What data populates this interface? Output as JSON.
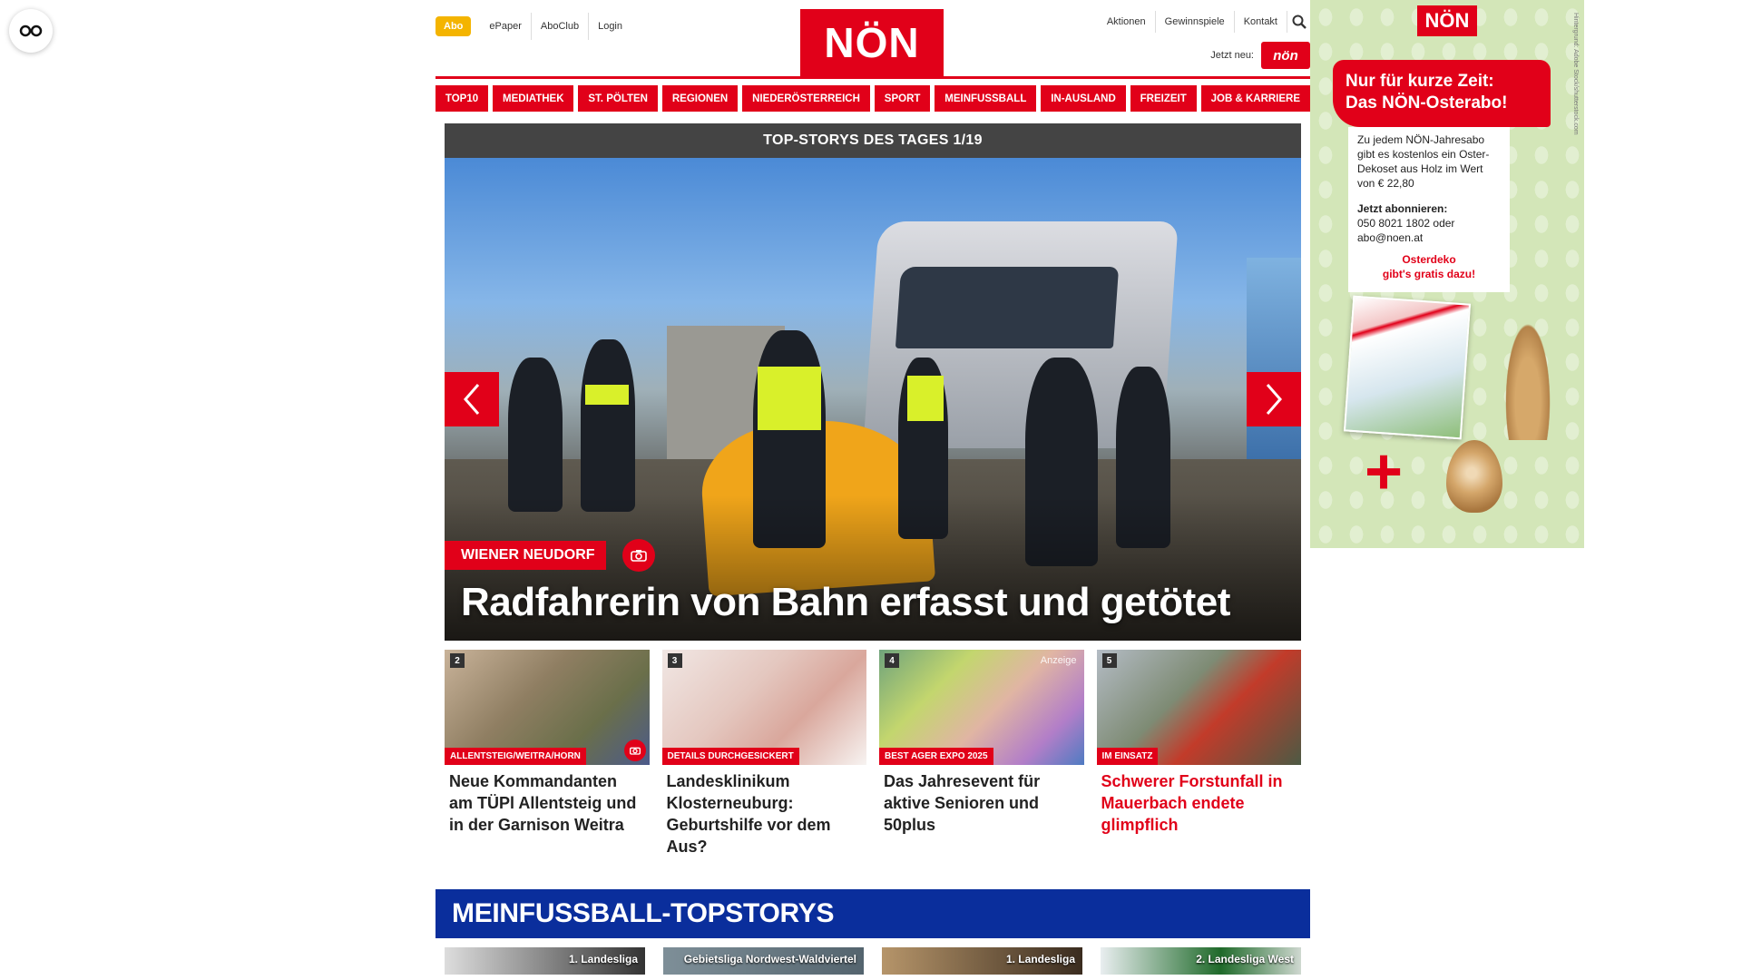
{
  "accessibility": {
    "label": "CO"
  },
  "header": {
    "abo_label": "Abo",
    "top_links": [
      "ePaper",
      "AboClub",
      "Login"
    ],
    "logo_text": "NÖN",
    "right_links": [
      "Aktionen",
      "Gewinnspiele",
      "Kontakt"
    ],
    "jetzt_label": "Jetzt neu:",
    "mini_logo_text": "nön"
  },
  "nav": {
    "items": [
      "TOP10",
      "MEDIATHEK",
      "ST. PÖLTEN",
      "REGIONEN",
      "NIEDERÖSTERREICH",
      "SPORT",
      "MEINFUSSBALL",
      "IN-AUSLAND",
      "FREIZEIT",
      "JOB & KARRIERE"
    ]
  },
  "carousel": {
    "heading": "TOP-STORYS DES TAGES 1/19",
    "kicker": "WIENER NEUDORF",
    "title": "Radfahrerin von Bahn erfasst und getötet"
  },
  "teasers": [
    {
      "rank": "2",
      "tag": "ALLENTSTEIG/WEITRA/HORN",
      "title": "Neue Kommandanten am TÜPl Allentsteig und in der Garnison Weitra",
      "ad": ""
    },
    {
      "rank": "3",
      "tag": "DETAILS DURCHGESICKERT",
      "title": "Landesklinikum Klosterneuburg: Geburtshilfe vor dem Aus?",
      "ad": ""
    },
    {
      "rank": "4",
      "tag": "BEST AGER EXPO 2025",
      "title": "Das Jahresevent für aktive Senioren und 50plus",
      "ad": "Anzeige"
    },
    {
      "rank": "5",
      "tag": "IM EINSATZ",
      "title": "Schwerer Forstunfall in Mauerbach endete glimpflich",
      "ad": ""
    }
  ],
  "section": {
    "title": "MEINFUSSBALL-TOPSTORYS",
    "items": [
      "1. Landesliga",
      "Gebietsliga Nordwest-Waldviertel",
      "1. Landesliga",
      "2. Landesliga West"
    ]
  },
  "ad": {
    "logo": "NÖN",
    "banner_line1": "Nur für kurze Zeit:",
    "banner_line2": "Das NÖN-Osterabo!",
    "text1": "Zu jedem NÖN-Jahresabo gibt es kostenlos ein Oster-Dekoset aus Holz im Wert von € 22,80",
    "text2_bold": "Jetzt abonnieren:",
    "text2": "050 8021 1802 oder abo@noen.at",
    "red_line1": "Osterdeko",
    "red_line2": "gibt's gratis dazu!",
    "plus": "+",
    "credit": "Hintergrund: Adobe Stock/shutterstock.com"
  },
  "colors": {
    "brand_red": "#e10019",
    "section_blue": "#0a2e9c",
    "abo_yellow": "#f4b400"
  }
}
